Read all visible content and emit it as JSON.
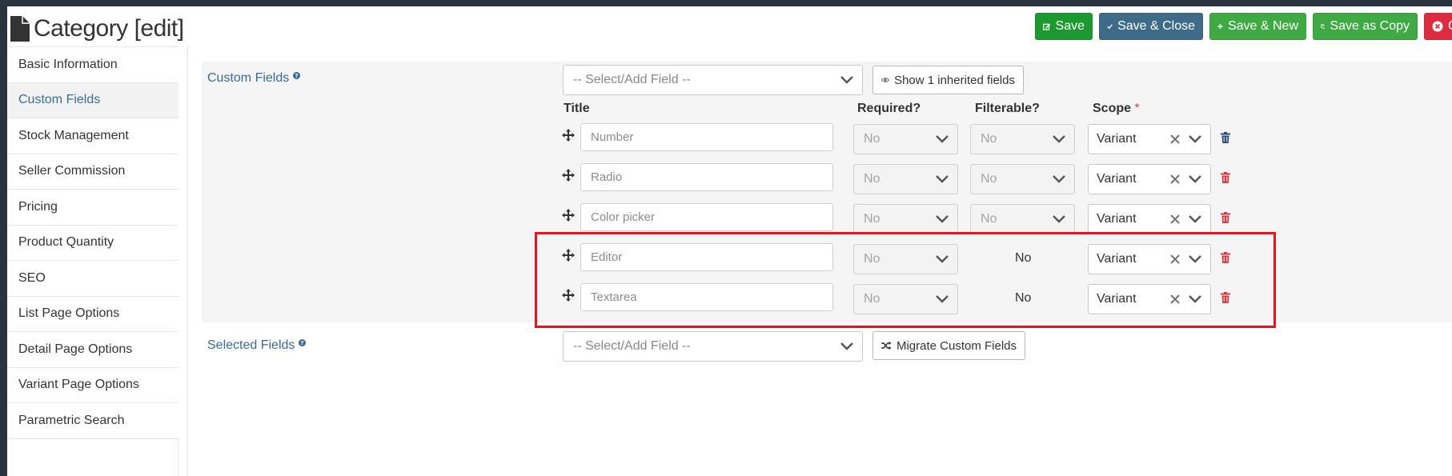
{
  "page": {
    "title": "Category [edit]"
  },
  "toolbar": {
    "save": "Save",
    "save_close": "Save & Close",
    "save_new": "Save & New",
    "save_copy": "Save as Copy",
    "close": "C"
  },
  "sidebar": {
    "items": [
      {
        "label": "Basic Information",
        "active": false
      },
      {
        "label": "Custom Fields",
        "active": true
      },
      {
        "label": "Stock Management",
        "active": false
      },
      {
        "label": "Seller Commission",
        "active": false
      },
      {
        "label": "Pricing",
        "active": false
      },
      {
        "label": "Product Quantity",
        "active": false
      },
      {
        "label": "SEO",
        "active": false
      },
      {
        "label": "List Page Options",
        "active": false
      },
      {
        "label": "Detail Page Options",
        "active": false
      },
      {
        "label": "Variant Page Options",
        "active": false
      },
      {
        "label": "Parametric Search",
        "active": false
      }
    ]
  },
  "custom_fields": {
    "label": "Custom Fields",
    "select_placeholder": "-- Select/Add Field --",
    "inherited_button": "Show 1 inherited fields",
    "columns": {
      "title": "Title",
      "required": "Required?",
      "filterable": "Filterable?",
      "scope": "Scope",
      "required_marker": "*"
    },
    "rows": [
      {
        "title": "Number",
        "required": "No",
        "filterable": "No",
        "scope": "Variant"
      },
      {
        "title": "Radio",
        "required": "No",
        "filterable": "No",
        "scope": "Variant"
      },
      {
        "title": "Color picker",
        "required": "No",
        "filterable": "No",
        "scope": "Variant"
      },
      {
        "title": "Editor",
        "required": "No",
        "filterable": "No",
        "scope": "Variant"
      },
      {
        "title": "Textarea",
        "required": "No",
        "filterable": "No",
        "scope": "Variant"
      }
    ]
  },
  "selected_fields": {
    "label": "Selected Fields",
    "select_placeholder": "-- Select/Add Field --",
    "migrate_button": "Migrate Custom Fields"
  },
  "colors": {
    "save": "#1c9a2f",
    "save_close": "#3e6b88",
    "save_new": "#3fa944",
    "close": "#dc2d40",
    "link": "#3a6a98",
    "highlight": "#e5141c"
  }
}
